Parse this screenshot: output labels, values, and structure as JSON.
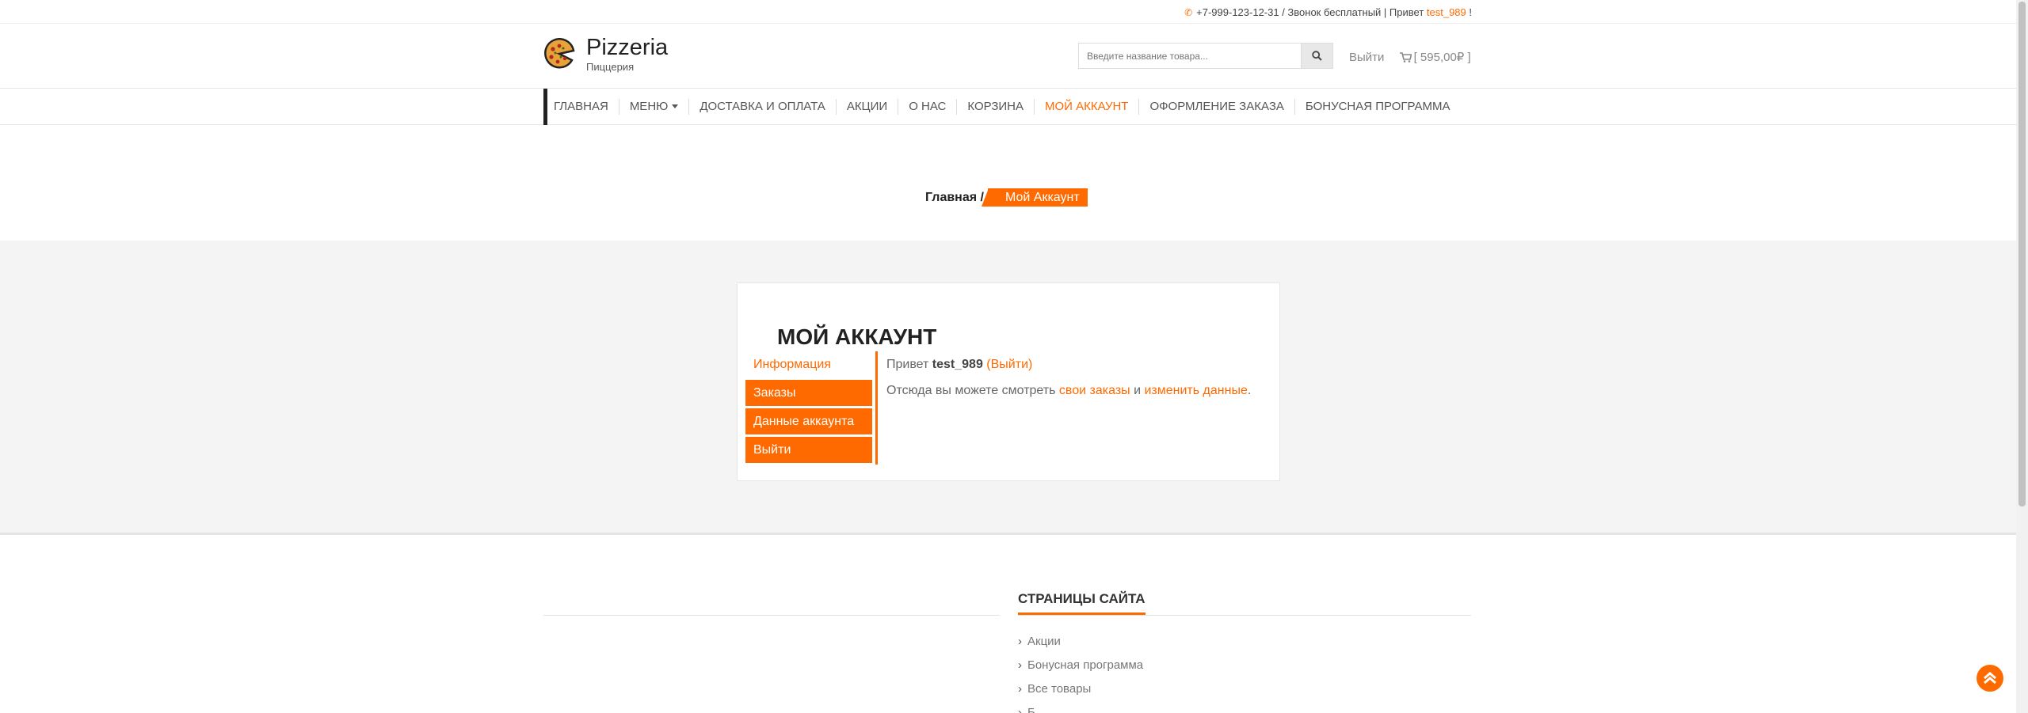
{
  "topbar": {
    "phone_icon": "phone-icon",
    "prefix": "+7-999-123-12-31 / Звонок бесплатный | Привет ",
    "username": "test_989",
    "suffix": " !"
  },
  "header": {
    "logo_icon": "pizza-logo-icon",
    "logo_title": "Pizzeria",
    "logo_subtitle": "Пиццерия",
    "search_placeholder": "Введите название товара...",
    "search_icon": "search-icon",
    "logout_label": "Выйти",
    "cart_icon": "cart-icon",
    "cart_total": "[ 595,00₽ ]"
  },
  "nav": {
    "items": [
      {
        "label": "Главная"
      },
      {
        "label": "Меню"
      },
      {
        "label": "Доставка и оплата"
      },
      {
        "label": "Акции"
      },
      {
        "label": "О нас"
      },
      {
        "label": "Корзина"
      },
      {
        "label": "Мой аккаунт",
        "active": true
      },
      {
        "label": "Оформление заказа"
      },
      {
        "label": "Бонусная программа"
      }
    ]
  },
  "breadcrumb": {
    "home": "Главная",
    "separator": "/",
    "current": "Мой Аккаунт"
  },
  "account": {
    "title": "Мой аккаунт",
    "menu": [
      "Информация",
      "Заказы",
      "Данные аккаунта",
      "Выйти"
    ],
    "greeting_prefix": "Привет ",
    "greeting_user": "test_989",
    "greeting_open": " (",
    "greeting_logout": "Выйти",
    "greeting_close": ")",
    "info_prefix": "Отсюда вы можете смотреть ",
    "info_orders_link": "свои заказы",
    "info_and": " и ",
    "info_edit_link": "изменить данные",
    "info_end": "."
  },
  "footer": {
    "pages_title": "Страницы сайта",
    "links": [
      "Акции",
      "Бонусная программа",
      "Все товары",
      "Б..."
    ]
  },
  "colors": {
    "accent": "#ff6a00",
    "section_gray": "#f4f4f4"
  },
  "scroll_top_icon": "chevron-up-icon"
}
